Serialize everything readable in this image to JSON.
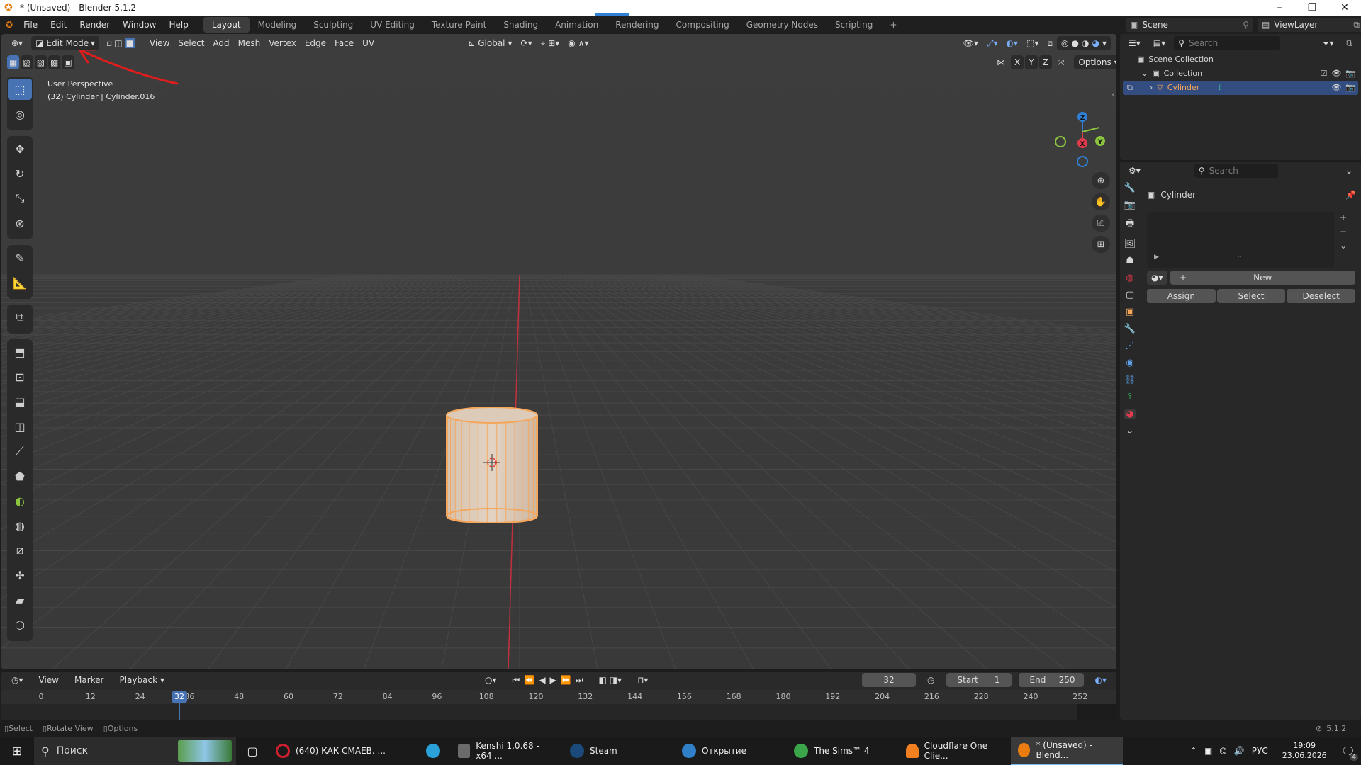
{
  "window": {
    "title": "* (Unsaved) - Blender 5.1.2",
    "controls": [
      "–",
      "❐",
      "✕"
    ]
  },
  "menubar": {
    "items": [
      "File",
      "Edit",
      "Render",
      "Window",
      "Help"
    ],
    "workspaces": [
      "Layout",
      "Modeling",
      "Sculpting",
      "UV Editing",
      "Texture Paint",
      "Shading",
      "Animation",
      "Rendering",
      "Compositing",
      "Geometry Nodes",
      "Scripting"
    ],
    "active_workspace": "Layout",
    "add_tab": "+",
    "scene_label": "Scene",
    "viewlayer_label": "ViewLayer"
  },
  "viewport_header": {
    "mode": "Edit Mode",
    "menus": [
      "View",
      "Select",
      "Add",
      "Mesh",
      "Vertex",
      "Edge",
      "Face",
      "UV"
    ],
    "transform_orientation": "Global",
    "options_label": "Options",
    "axis_labels": [
      "X",
      "Y",
      "Z"
    ]
  },
  "viewport_info": {
    "line1": "User Perspective",
    "line2": "(32) Cylinder | Cylinder.016"
  },
  "gizmo": {
    "x": "X",
    "y": "Y",
    "z": "Z"
  },
  "outliner": {
    "search_placeholder": "Search",
    "scene_collection": "Scene Collection",
    "collection": "Collection",
    "object": "Cylinder"
  },
  "properties": {
    "search_placeholder": "Search",
    "object_name": "Cylinder",
    "new_label": "New",
    "assign_label": "Assign",
    "select_label": "Select",
    "deselect_label": "Deselect"
  },
  "timeline": {
    "menus": [
      "View",
      "Marker",
      "Playback"
    ],
    "current_frame": "32",
    "start_label": "Start",
    "start_value": "1",
    "end_label": "End",
    "end_value": "250",
    "ruler": [
      "0",
      "12",
      "24",
      "36",
      "48",
      "60",
      "72",
      "84",
      "96",
      "108",
      "120",
      "132",
      "144",
      "156",
      "168",
      "180",
      "192",
      "204",
      "216",
      "228",
      "240",
      "252"
    ],
    "playhead_label": "32"
  },
  "statusbar": {
    "select": "Select",
    "rotate_view": "Rotate View",
    "options": "Options",
    "version": "5.1.2"
  },
  "taskbar": {
    "search_placeholder": "Поиск",
    "items": [
      {
        "label": "(640) КАК СМАЕВ. ...",
        "color": "#cc1f2f"
      },
      {
        "label": "",
        "color": "#2aa1d8"
      },
      {
        "label": "Kenshi 1.0.68 - x64 ...",
        "color": "#6b6b6b"
      },
      {
        "label": "Steam",
        "color": "#1b4a7a"
      },
      {
        "label": "Открытие",
        "color": "#2f7fc9"
      },
      {
        "label": "The Sims™ 4",
        "color": "#3aa54a"
      },
      {
        "label": "Cloudflare One Clie...",
        "color": "#f38020"
      },
      {
        "label": "* (Unsaved) - Blend...",
        "color": "#e87d0d"
      }
    ],
    "lang": "РУС",
    "time": "19:09",
    "date": "23.06.2026",
    "notifications": "4"
  },
  "colors": {
    "accent": "#4772b3",
    "mesh_selected": "#f5a65a",
    "x_axis": "#e23b4b",
    "y_axis": "#8bc53f",
    "z_axis": "#2f80d6"
  }
}
